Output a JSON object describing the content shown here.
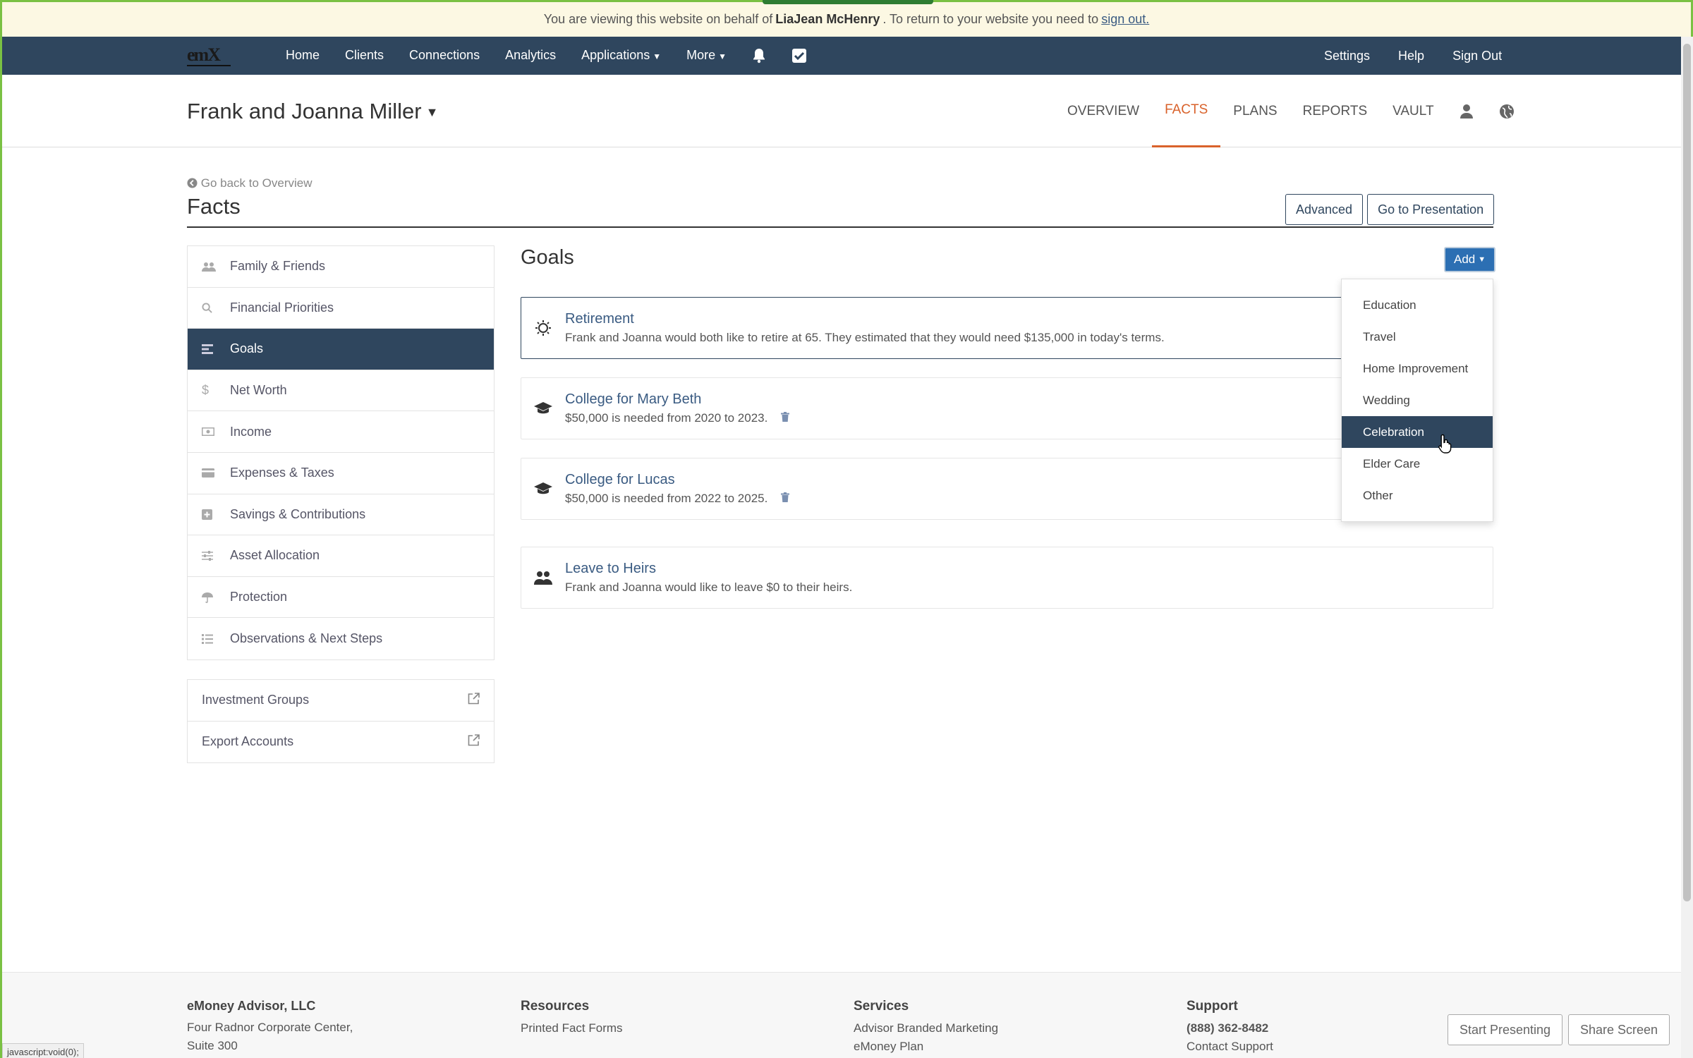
{
  "banner": {
    "prefix": "You are viewing this website on behalf of",
    "user": "LiaJean McHenry",
    "middle": ".  To return to your website you need to",
    "link": "sign out."
  },
  "topnav": {
    "logo": "emX",
    "items": [
      "Home",
      "Clients",
      "Connections",
      "Analytics",
      "Applications",
      "More"
    ],
    "right": [
      "Settings",
      "Help",
      "Sign Out"
    ],
    "icons": [
      "bell-icon",
      "checkbox-icon"
    ]
  },
  "client": {
    "name": "Frank and Joanna Miller",
    "tabs": [
      "OVERVIEW",
      "FACTS",
      "PLANS",
      "REPORTS",
      "VAULT"
    ],
    "active_tab": "FACTS"
  },
  "page": {
    "back_link": "Go back to Overview",
    "title": "Facts",
    "buttons": [
      "Advanced",
      "Go to Presentation"
    ]
  },
  "sidebar": {
    "items": [
      {
        "label": "Family & Friends",
        "icon": "users-icon"
      },
      {
        "label": "Financial Priorities",
        "icon": "search-icon"
      },
      {
        "label": "Goals",
        "icon": "list-icon",
        "active": true
      },
      {
        "label": "Net Worth",
        "icon": "dollar-icon"
      },
      {
        "label": "Income",
        "icon": "money-icon"
      },
      {
        "label": "Expenses & Taxes",
        "icon": "credit-card-icon"
      },
      {
        "label": "Savings & Contributions",
        "icon": "plus-square-icon"
      },
      {
        "label": "Asset Allocation",
        "icon": "sliders-icon"
      },
      {
        "label": "Protection",
        "icon": "umbrella-icon"
      },
      {
        "label": "Observations & Next Steps",
        "icon": "list-ul-icon"
      }
    ],
    "external": [
      "Investment Groups",
      "Export Accounts"
    ]
  },
  "goals": {
    "title": "Goals",
    "add_label": "Add",
    "items": [
      {
        "title": "Retirement",
        "desc": "Frank and Joanna would both like to retire at 65. They estimated that they would need $135,000 in today's terms.",
        "icon": "sun-icon"
      },
      {
        "title": "College for Mary Beth",
        "desc": "$50,000 is needed from 2020 to 2023.",
        "icon": "graduation-cap-icon"
      },
      {
        "title": "College for Lucas",
        "desc": "$50,000 is needed from 2022 to 2025.",
        "icon": "graduation-cap-icon"
      },
      {
        "title": "Leave to Heirs",
        "desc": "Frank and Joanna would like to leave $0 to their heirs.",
        "icon": "users-icon"
      }
    ]
  },
  "dropdown": {
    "items": [
      "Education",
      "Travel",
      "Home Improvement",
      "Wedding",
      "Celebration",
      "Elder Care",
      "Other"
    ],
    "highlighted": "Celebration"
  },
  "footer": {
    "company": "eMoney Advisor, LLC",
    "address1": "Four Radnor Corporate Center,",
    "address2": "Suite 300",
    "resources_title": "Resources",
    "resources_link": "Printed Fact Forms",
    "services_title": "Services",
    "services_link": "Advisor Branded Marketing",
    "services_link2": "eMoney Plan",
    "support_title": "Support",
    "support_phone": "(888) 362-8482",
    "support_link": "Contact Support",
    "buttons": [
      "Start Presenting",
      "Share Screen"
    ]
  },
  "statusbar": "javascript:void(0);"
}
